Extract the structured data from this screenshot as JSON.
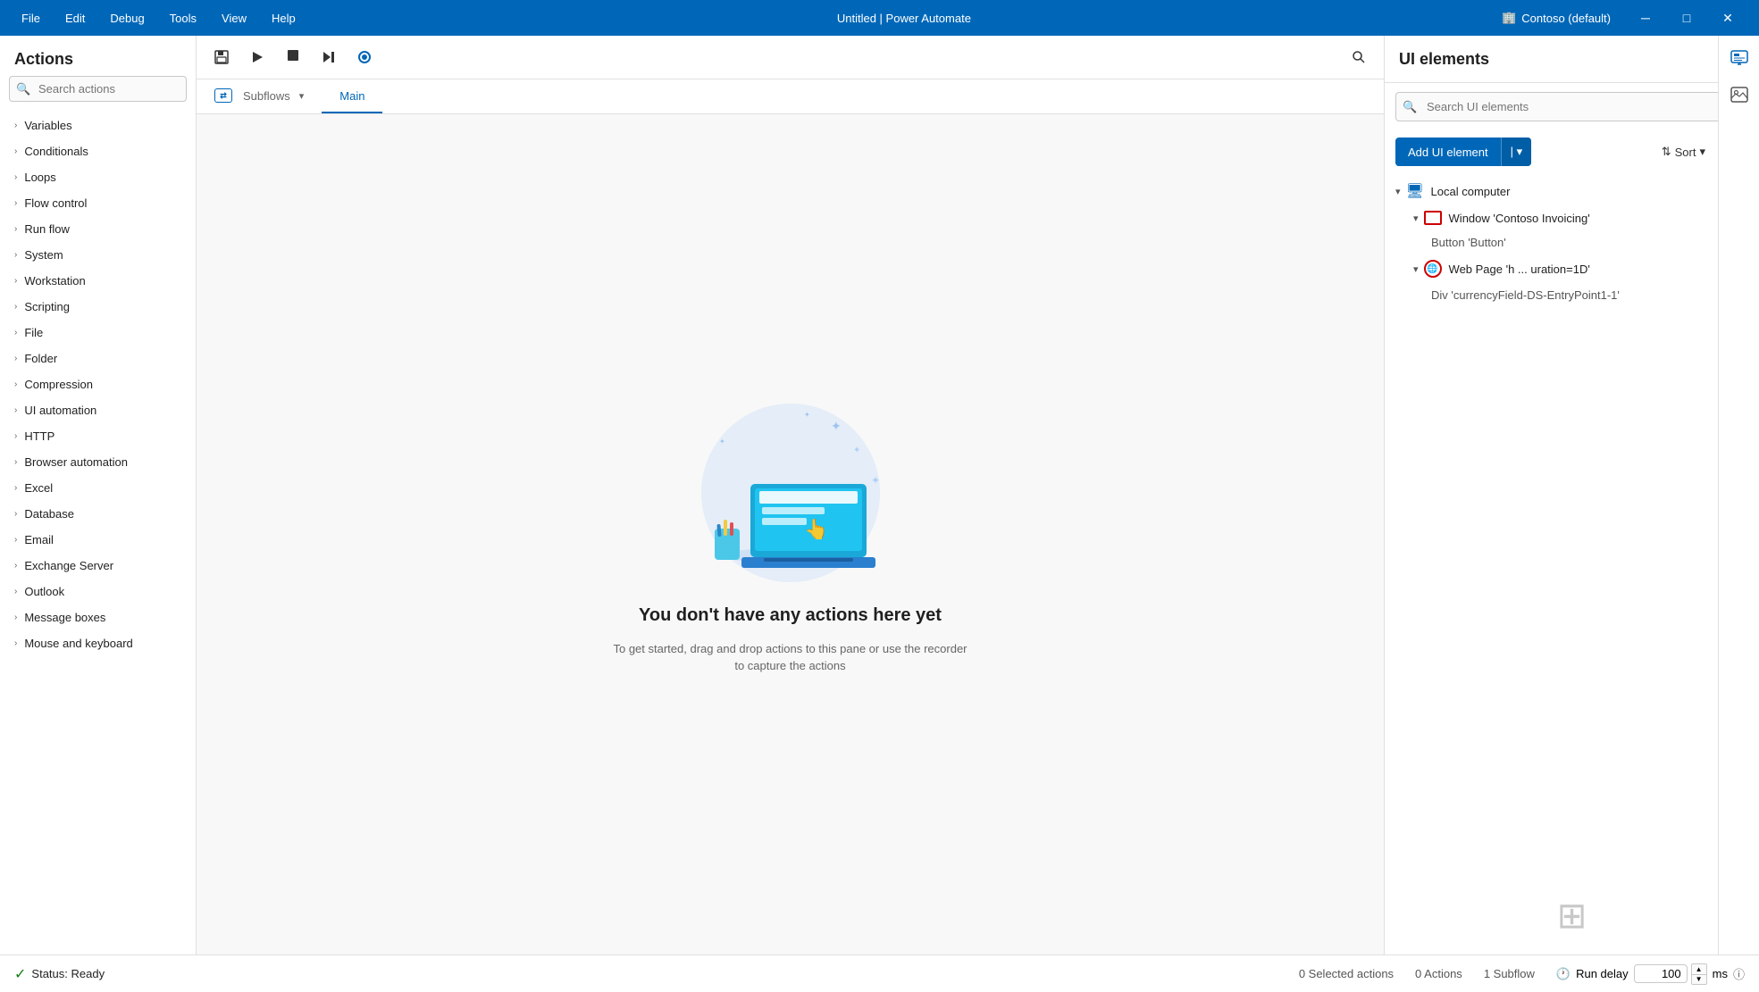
{
  "titlebar": {
    "menu_items": [
      "File",
      "Edit",
      "Debug",
      "Tools",
      "View",
      "Help"
    ],
    "title": "Untitled | Power Automate",
    "account": "Contoso (default)",
    "controls": [
      "─",
      "□",
      "✕"
    ]
  },
  "actions_panel": {
    "heading": "Actions",
    "search_placeholder": "Search actions",
    "items": [
      "Variables",
      "Conditionals",
      "Loops",
      "Flow control",
      "Run flow",
      "System",
      "Workstation",
      "Scripting",
      "File",
      "Folder",
      "Compression",
      "UI automation",
      "HTTP",
      "Browser automation",
      "Excel",
      "Database",
      "Email",
      "Exchange Server",
      "Outlook",
      "Message boxes",
      "Mouse and keyboard"
    ]
  },
  "canvas": {
    "toolbar_buttons": [
      "save",
      "run",
      "stop",
      "step",
      "record"
    ],
    "tabs": [
      {
        "label": "Subflows",
        "icon": "subflow",
        "active": false
      },
      {
        "label": "Main",
        "active": true
      }
    ],
    "empty_state": {
      "title": "You don't have any actions here yet",
      "description": "To get started, drag and drop actions to this pane\nor use the recorder to capture the actions"
    }
  },
  "ui_elements_panel": {
    "heading": "UI elements",
    "search_placeholder": "Search UI elements",
    "add_button_label": "Add UI element",
    "sort_label": "Sort",
    "tree": [
      {
        "level": 0,
        "label": "Local computer",
        "icon": "computer",
        "expanded": true,
        "children": [
          {
            "level": 1,
            "label": "Window 'Contoso Invoicing'",
            "icon": "window",
            "expanded": true,
            "children": [
              {
                "level": 2,
                "label": "Button 'Button'",
                "icon": "none"
              }
            ]
          },
          {
            "level": 1,
            "label": "Web Page 'h ... uration=1D'",
            "icon": "globe",
            "expanded": true,
            "children": [
              {
                "level": 2,
                "label": "Div 'currencyField-DS-EntryPoint1-1'",
                "icon": "none"
              }
            ]
          }
        ]
      }
    ]
  },
  "status_bar": {
    "status_text": "Status: Ready",
    "selected_actions": "0 Selected actions",
    "actions_count": "0 Actions",
    "subflow_count": "1 Subflow",
    "run_delay_label": "Run delay",
    "run_delay_value": "100",
    "run_delay_unit": "ms"
  }
}
